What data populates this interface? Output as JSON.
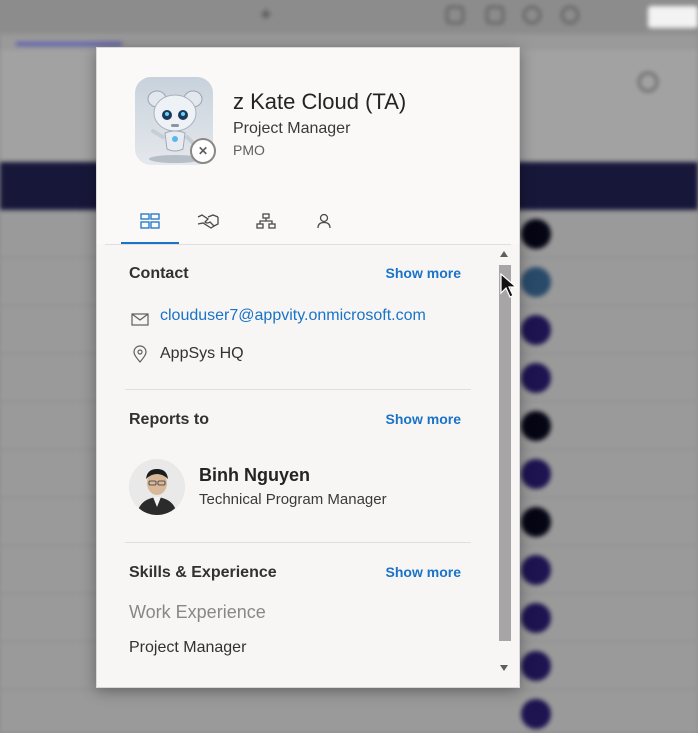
{
  "profile": {
    "name": "z Kate Cloud (TA)",
    "job_title": "Project Manager",
    "department": "PMO",
    "presence": "offline"
  },
  "tabs": [
    {
      "name": "overview",
      "icon": "overview-icon",
      "active": true
    },
    {
      "name": "messages",
      "icon": "handshake-icon",
      "active": false
    },
    {
      "name": "organization",
      "icon": "org-chart-icon",
      "active": false
    },
    {
      "name": "profile",
      "icon": "person-icon",
      "active": false
    }
  ],
  "contact": {
    "title": "Contact",
    "show_more": "Show more",
    "email": "clouduser7@appvity.onmicrosoft.com",
    "location": "AppSys HQ"
  },
  "reports_to": {
    "title": "Reports to",
    "show_more": "Show more",
    "manager_name": "Binh Nguyen",
    "manager_title": "Technical Program Manager"
  },
  "skills": {
    "title": "Skills & Experience",
    "show_more": "Show more",
    "subheading": "Work Experience",
    "role": "Project Manager"
  },
  "colors": {
    "accent": "#1a73c8",
    "card_bg": "#f7f6f4",
    "header_band": "#17173a"
  }
}
